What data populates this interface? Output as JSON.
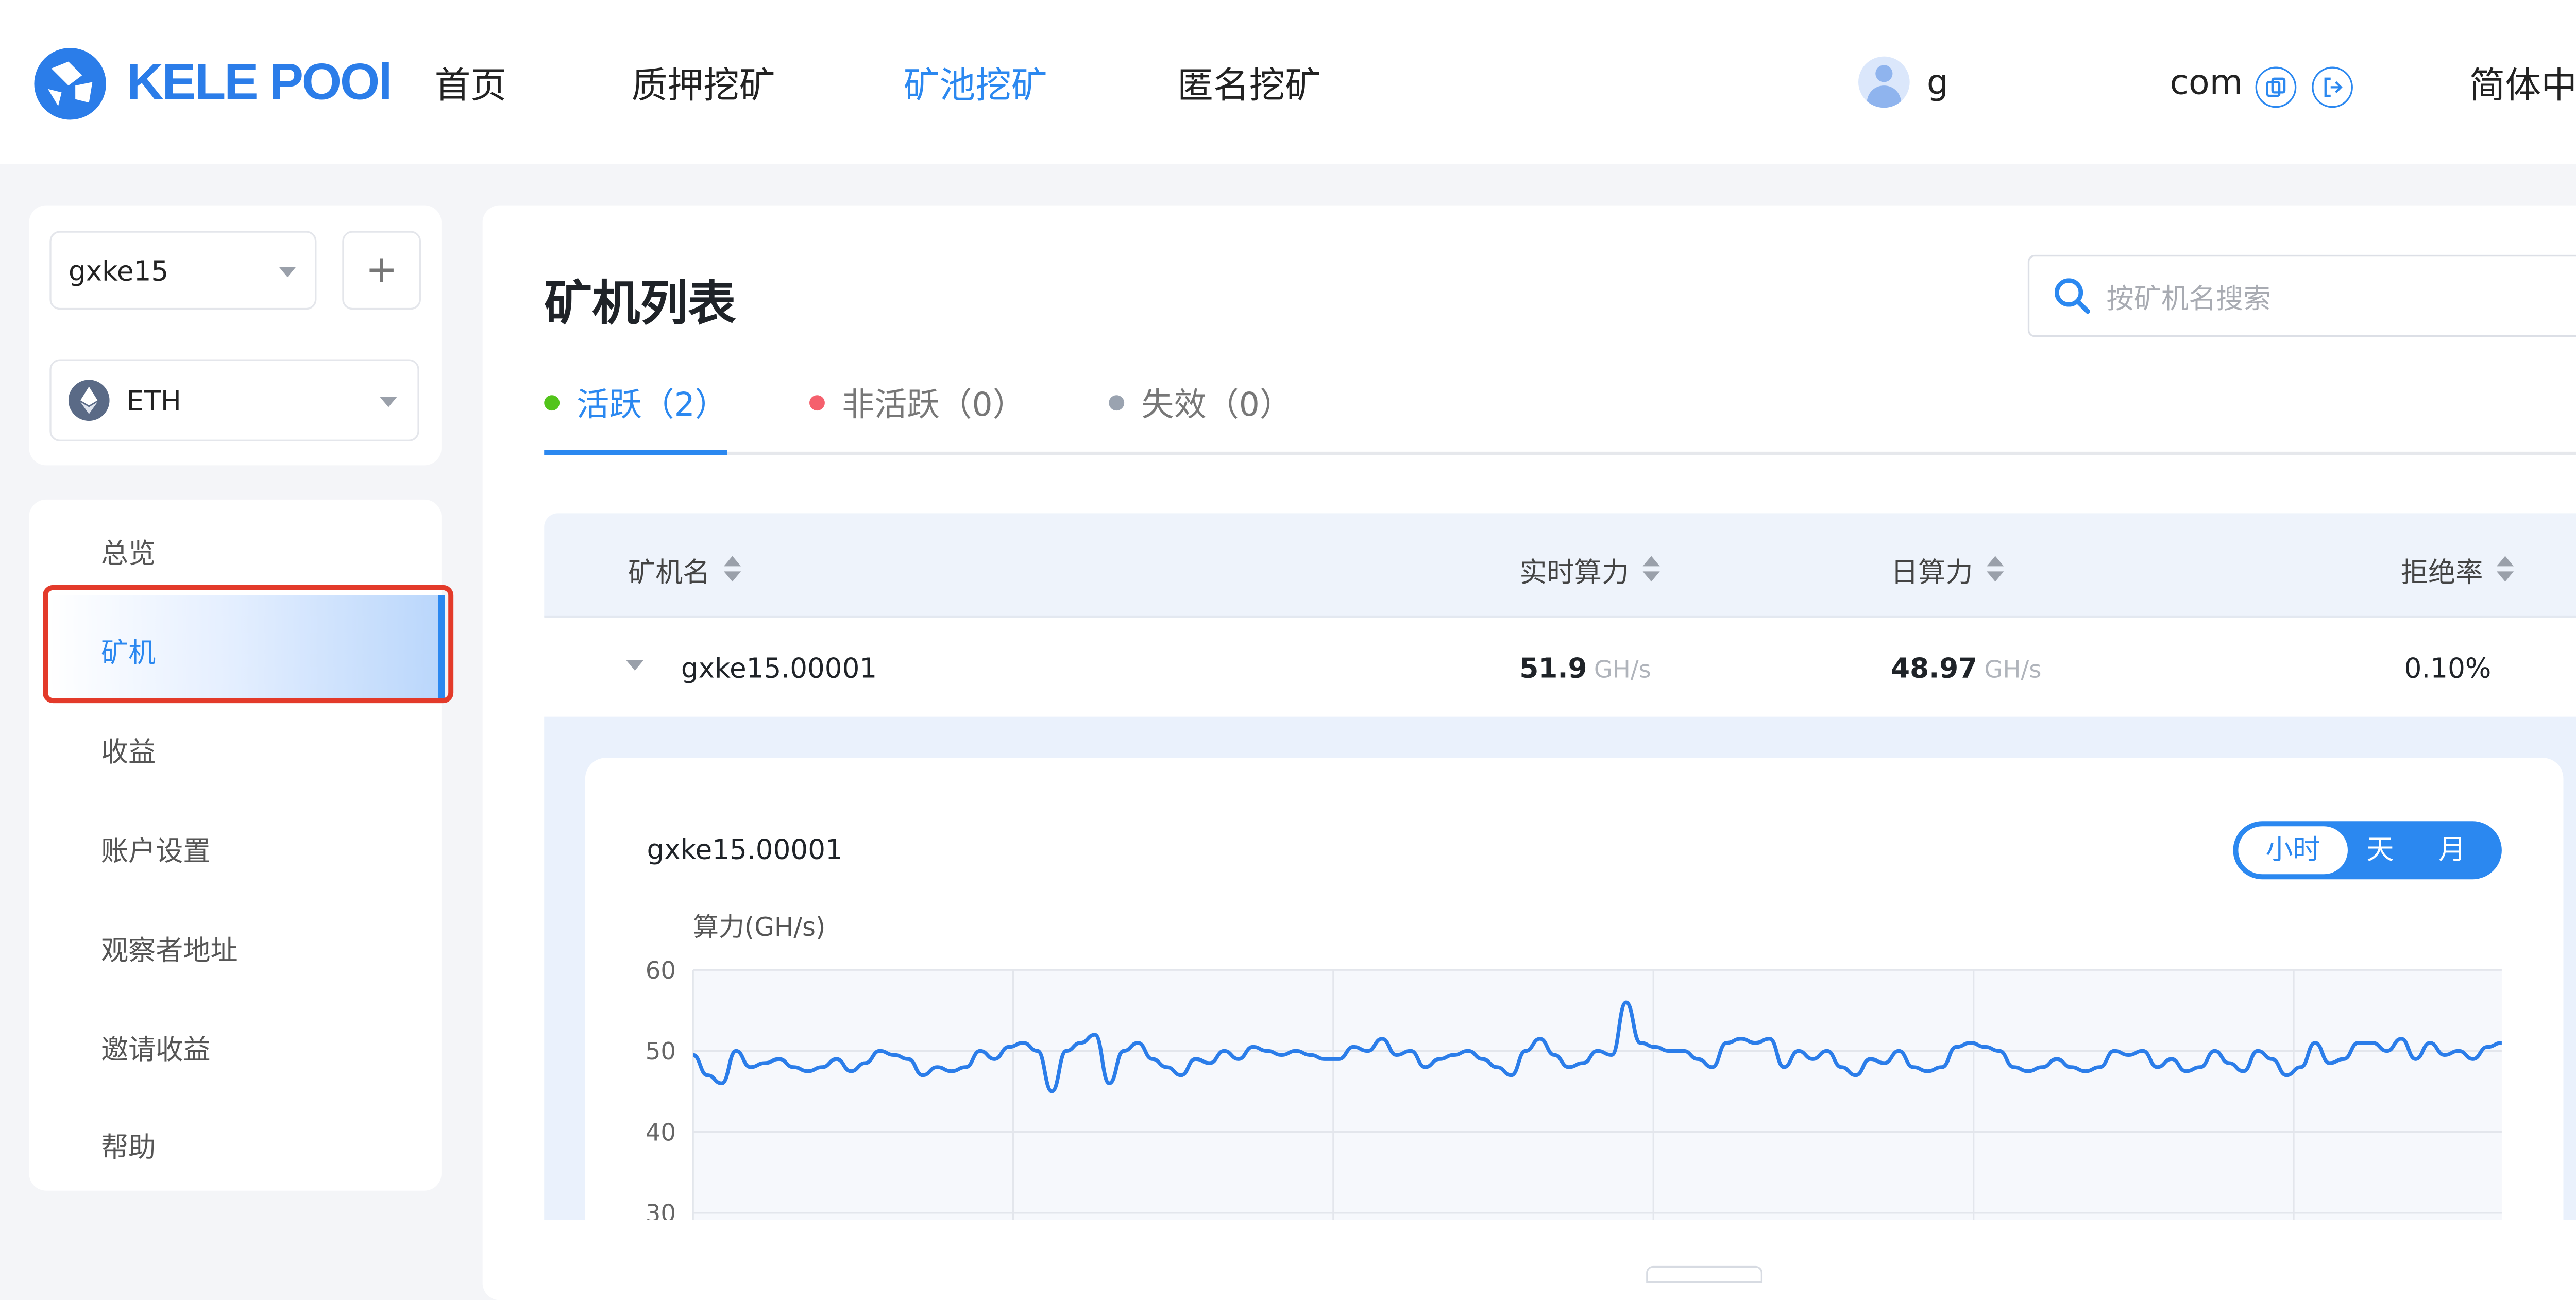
{
  "header": {
    "logo_text": "KELE POOl",
    "nav": [
      "首页",
      "质押挖矿",
      "矿池挖矿",
      "匿名挖矿"
    ],
    "active_nav": "矿池挖矿",
    "user_name_prefix": "g",
    "email_suffix": "com",
    "language": "简体中文"
  },
  "sidebar": {
    "account_select": "gxke15",
    "coin_select": "ETH",
    "menu": [
      "总览",
      "矿机",
      "收益",
      "账户设置",
      "观察者地址",
      "邀请收益",
      "帮助"
    ],
    "active_menu": "矿机"
  },
  "main": {
    "title": "矿机列表",
    "search_placeholder": "按矿机名搜索",
    "tabs": [
      {
        "label": "活跃（2）",
        "color": "#52c41a",
        "active": true
      },
      {
        "label": "非活跃（0）",
        "color": "#f5606d",
        "active": false
      },
      {
        "label": "失效（0）",
        "color": "#9aa3b0",
        "active": false
      }
    ],
    "columns": [
      "矿机名",
      "实时算力",
      "日算力",
      "拒绝率"
    ],
    "rows": [
      {
        "name": "gxke15.00001",
        "realtime": "51.9",
        "realtime_unit": "GH/s",
        "daily": "48.97",
        "daily_unit": "GH/s",
        "reject": "0.10%"
      }
    ],
    "detail": {
      "worker_name": "gxke15.00001",
      "ranges": [
        "小时",
        "天",
        "月"
      ],
      "active_range": "小时"
    }
  },
  "colors": {
    "accent": "#2b88f0",
    "highlight_border": "#e33a2a"
  },
  "chart_data": {
    "type": "line",
    "title": "",
    "ylabel": "算力(GH/s)",
    "ylim": [
      30,
      60
    ],
    "yticks": [
      60,
      50,
      40,
      30
    ],
    "grid": true,
    "series": [
      {
        "values": [
          49.5,
          47,
          46,
          50,
          48,
          48.5,
          49,
          48,
          47.5,
          48,
          49,
          47.5,
          48.5,
          50,
          49.5,
          49,
          47,
          48,
          47.5,
          48,
          50,
          49,
          50.5,
          51,
          50,
          45,
          50,
          51,
          52,
          46,
          50,
          51,
          49,
          48,
          47,
          49,
          48.5,
          50,
          49,
          50.5,
          50,
          49.5,
          50,
          49.5,
          49,
          49,
          50.5,
          50,
          51.5,
          49.5,
          50,
          48,
          49,
          49.5,
          50,
          49,
          48,
          47,
          50,
          51.5,
          49.5,
          48,
          48.5,
          50,
          49.5,
          56,
          51,
          50.5,
          50,
          50,
          49,
          48,
          51,
          51.5,
          51,
          51.5,
          48,
          50,
          49,
          50,
          48,
          47,
          49,
          48.5,
          50,
          48,
          47.5,
          48,
          50.5,
          51,
          50.5,
          50,
          48,
          47.5,
          48,
          49,
          48,
          47.5,
          48,
          50,
          49.5,
          50,
          48,
          49,
          47.5,
          48,
          50,
          48.5,
          47.5,
          50,
          49,
          47,
          48,
          51,
          48.5,
          49,
          51,
          51,
          50,
          51.5,
          49,
          51,
          49.5,
          50,
          49,
          50.5,
          51
        ]
      }
    ]
  }
}
